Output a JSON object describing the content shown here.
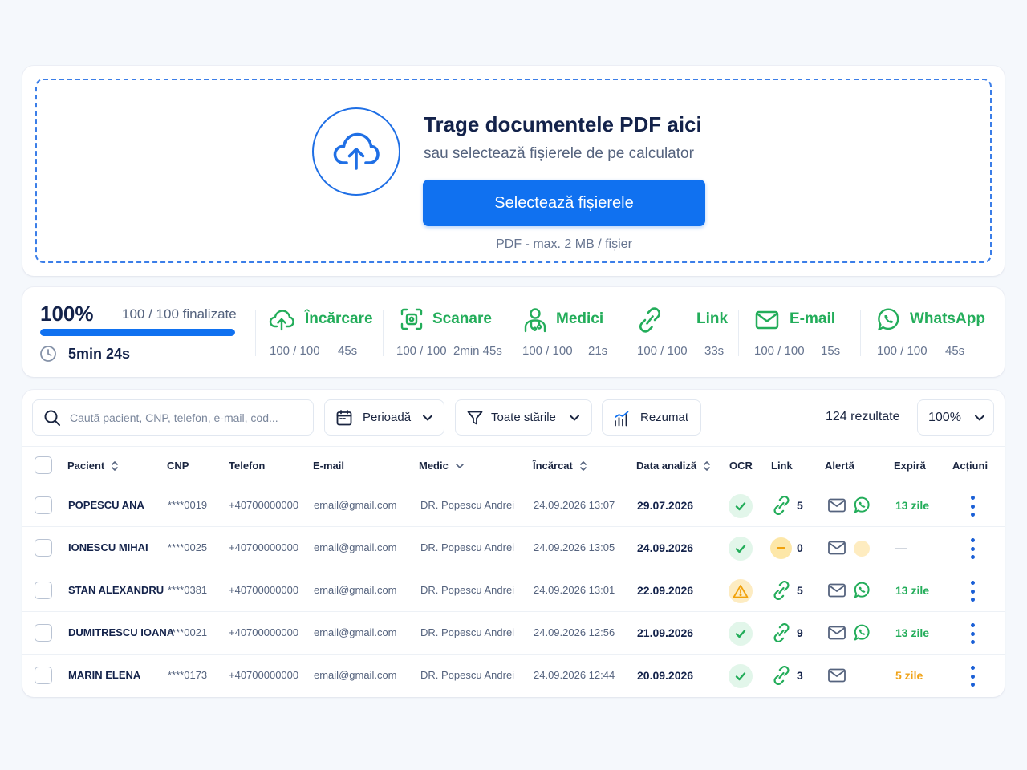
{
  "upload": {
    "title": "Trage documentele PDF aici",
    "subtitle": "sau selectează fișierele de pe calculator",
    "button": "Selectează fișierele",
    "hint": "PDF - max. 2 MB / fișier",
    "icon": "cloud-upload-icon"
  },
  "progress": {
    "percent_label": "100%",
    "finalized": "100 / 100 finalizate",
    "fraction": 1.0,
    "elapsed": "5min 24s",
    "steps": [
      {
        "name": "Încărcare",
        "count": "100 / 100",
        "time": "45s",
        "icon": "cloud-upload-icon"
      },
      {
        "name": "Scanare",
        "count": "100 / 100",
        "time": "2min 45s",
        "icon": "scan-icon"
      },
      {
        "name": "Medici",
        "count": "100 / 100",
        "time": "21s",
        "icon": "doctor-icon"
      },
      {
        "name": "Link",
        "count": "100 / 100",
        "time": "33s",
        "icon": "link-icon"
      },
      {
        "name": "E-mail",
        "count": "100 / 100",
        "time": "15s",
        "icon": "mail-icon"
      },
      {
        "name": "WhatsApp",
        "count": "100 / 100",
        "time": "45s",
        "icon": "whatsapp-icon"
      }
    ]
  },
  "toolbar": {
    "search_placeholder": "Caută pacient, CNP, telefon, e-mail, cod...",
    "period": "Perioadă",
    "state": "Toate stările",
    "summary": "Rezumat",
    "results": "124 rezultate",
    "zoom": "100%"
  },
  "table": {
    "columns": {
      "patient": "Pacient",
      "cnp": "CNP",
      "phone": "Telefon",
      "email": "E-mail",
      "doctor": "Medic",
      "uploaded": "Încărcat",
      "analysis_date": "Data analiză",
      "ocr": "OCR",
      "link": "Link",
      "alert": "Alertă",
      "expires": "Expiră",
      "actions": "Acțiuni"
    },
    "rows": [
      {
        "patient": "POPESCU ANA",
        "cnp": "****0019",
        "phone": "+40700000000",
        "email": "email@gmail.com",
        "doctor": "DR. Popescu Andrei",
        "uploaded": "24.09.2026 13:07",
        "analysis_date": "29.07.2026",
        "ocr": "ok",
        "link_state": "ok",
        "link_count": "5",
        "whatsapp": "sent",
        "expires": "13 zile",
        "expires_color": "#23ad5a"
      },
      {
        "patient": "IONESCU MIHAI",
        "cnp": "****0025",
        "phone": "+40700000000",
        "email": "email@gmail.com",
        "doctor": "DR. Popescu Andrei",
        "uploaded": "24.09.2026 13:05",
        "analysis_date": "24.09.2026",
        "ocr": "ok",
        "link_state": "pending",
        "link_count": "0",
        "whatsapp": "pending",
        "expires": "—",
        "expires_color": "#8a96aa"
      },
      {
        "patient": "STAN ALEXANDRU",
        "cnp": "****0381",
        "phone": "+40700000000",
        "email": "email@gmail.com",
        "doctor": "DR. Popescu Andrei",
        "uploaded": "24.09.2026 13:01",
        "analysis_date": "22.09.2026",
        "ocr": "warning",
        "link_state": "ok",
        "link_count": "5",
        "whatsapp": "sent",
        "expires": "13 zile",
        "expires_color": "#23ad5a"
      },
      {
        "patient": "DUMITRESCU IOANA",
        "cnp": "****0021",
        "phone": "+40700000000",
        "email": "email@gmail.com",
        "doctor": "DR. Popescu Andrei",
        "uploaded": "24.09.2026 12:56",
        "analysis_date": "21.09.2026",
        "ocr": "ok",
        "link_state": "ok",
        "link_count": "9",
        "whatsapp": "sent",
        "expires": "13 zile",
        "expires_color": "#23ad5a"
      },
      {
        "patient": "MARIN ELENA",
        "cnp": "****0173",
        "phone": "+40700000000",
        "email": "email@gmail.com",
        "doctor": "DR. Popescu Andrei",
        "uploaded": "24.09.2026 12:44",
        "analysis_date": "20.09.2026",
        "ocr": "ok",
        "link_state": "ok",
        "link_count": "3",
        "whatsapp": "none",
        "expires": "5 zile",
        "expires_color": "#f0a318"
      }
    ]
  },
  "colors": {
    "accent": "#1071f0",
    "success": "#23ad5a",
    "warning": "#f1a10a",
    "text_dark": "#13224a"
  }
}
